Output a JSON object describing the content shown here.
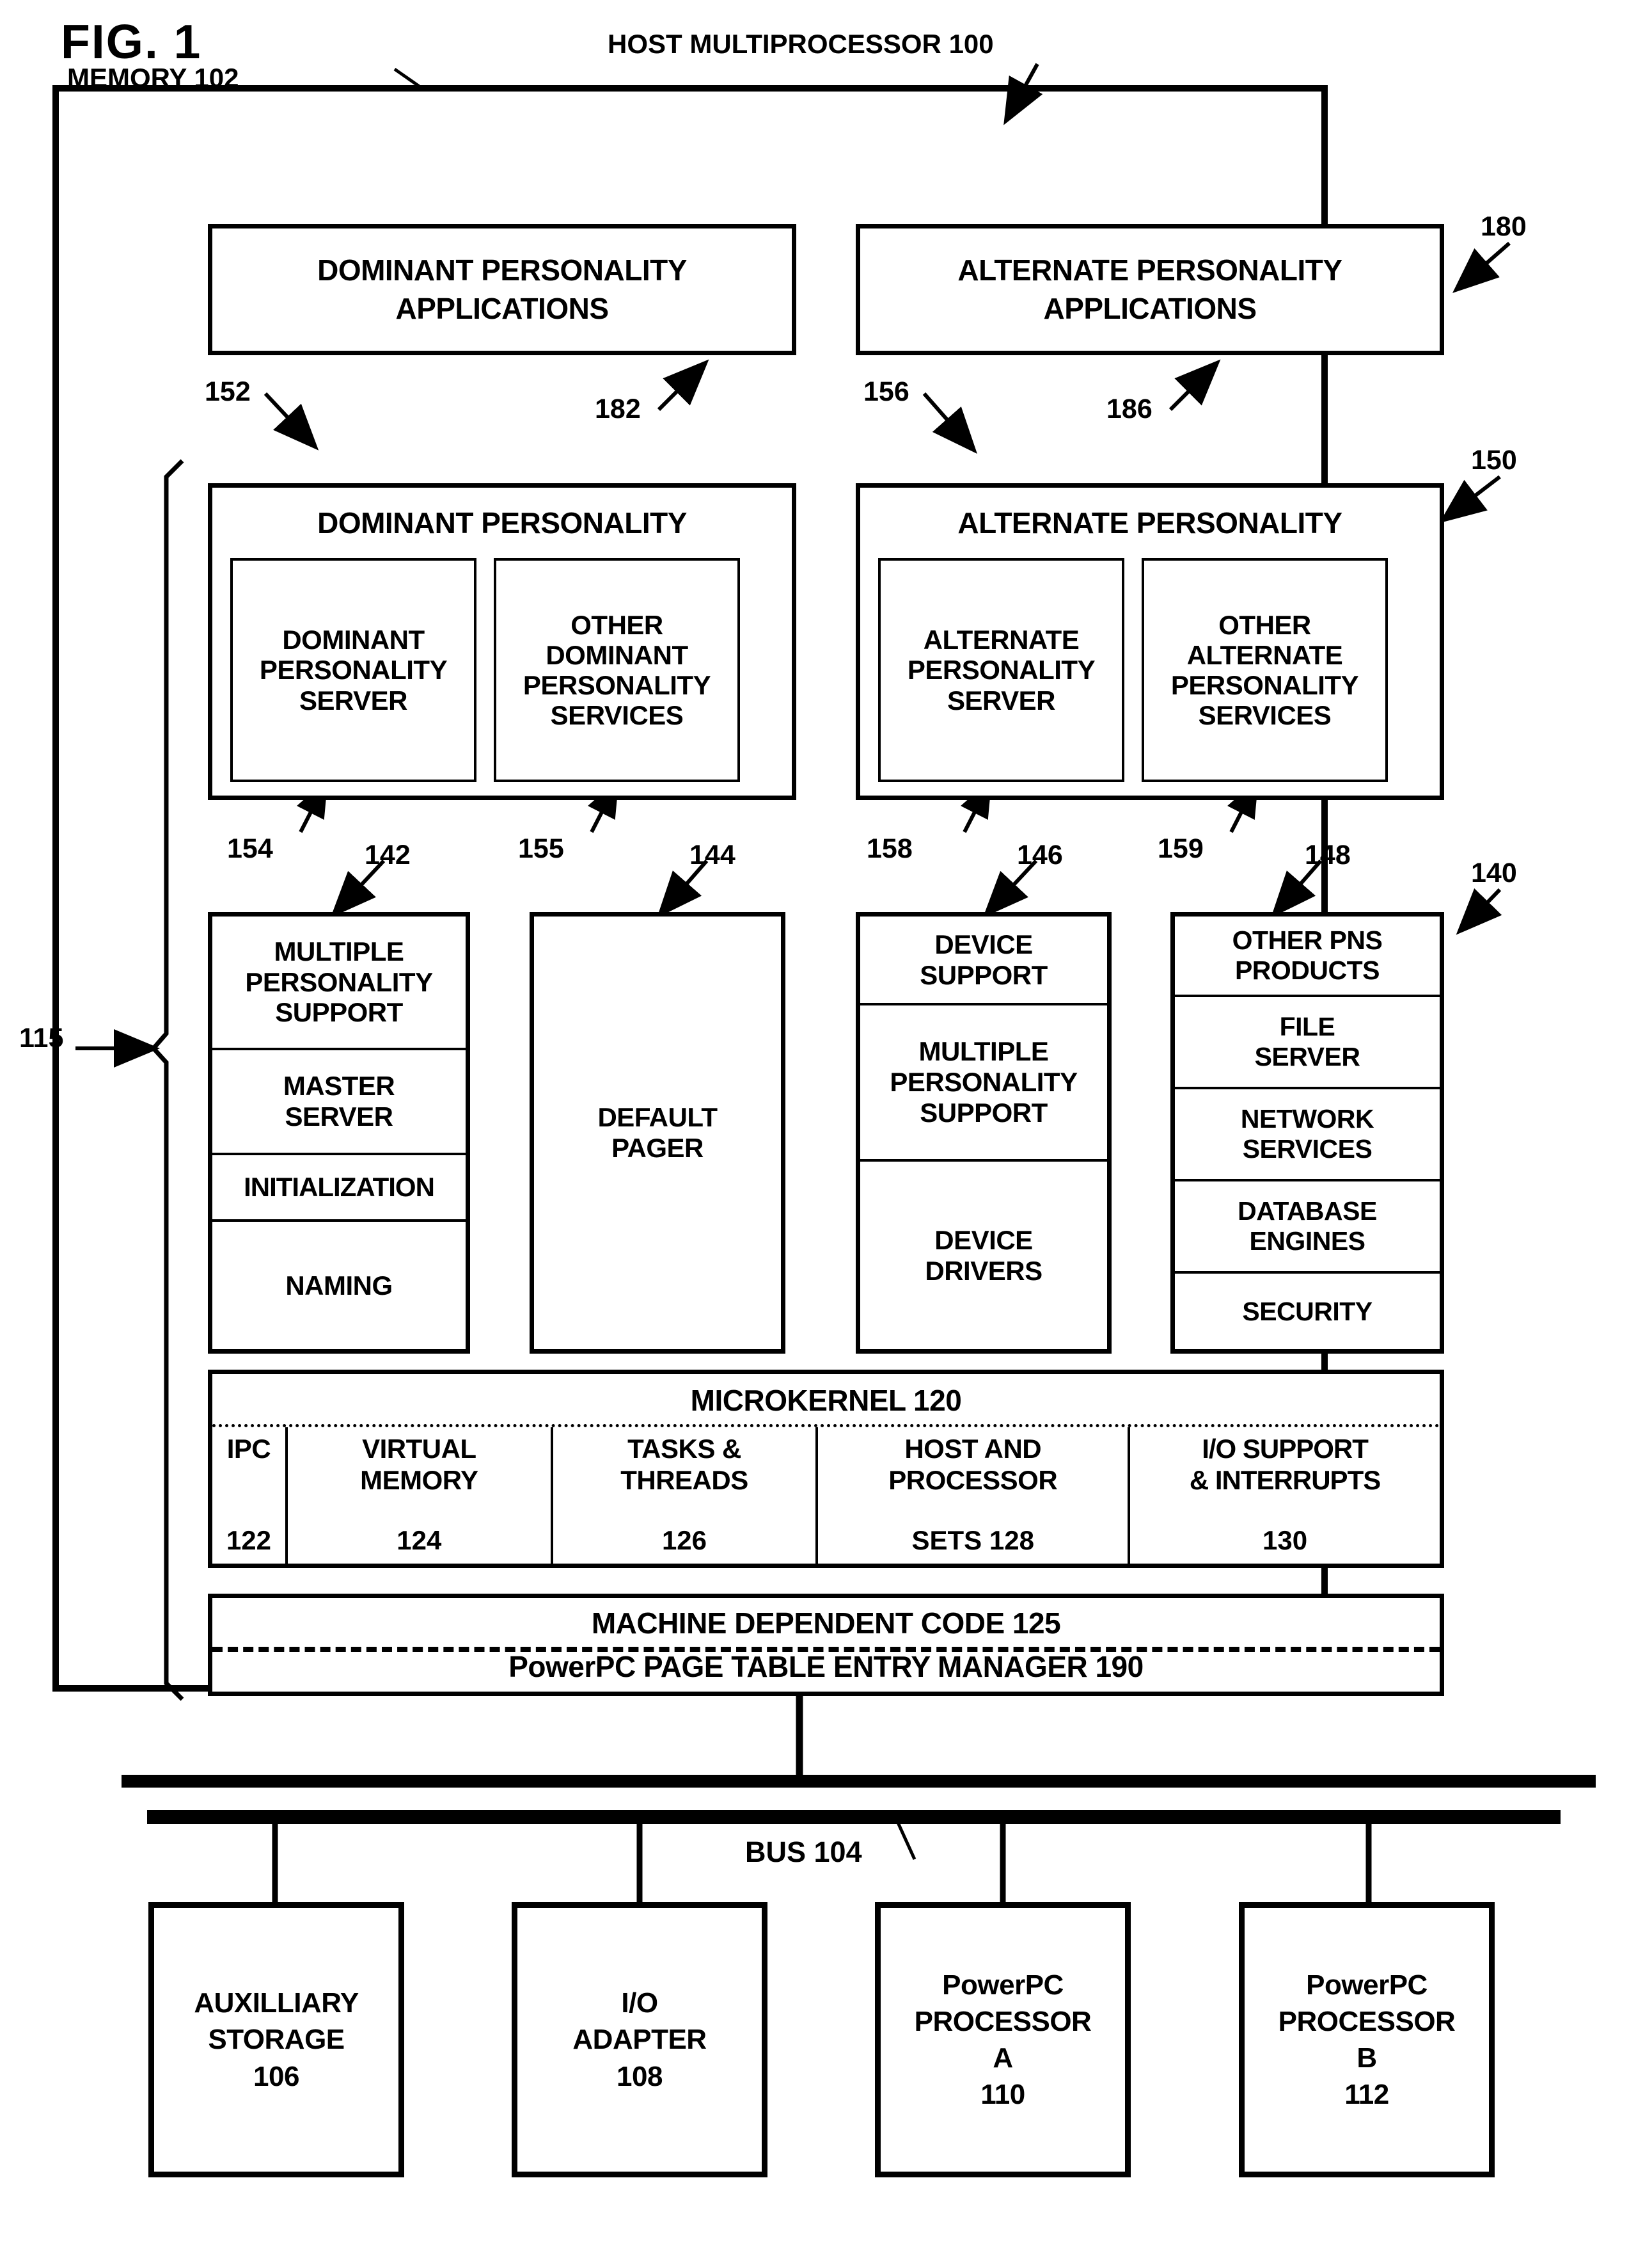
{
  "figure": {
    "label": "FIG. 1",
    "host_title": "HOST MULTIPROCESSOR 100",
    "memory_title": "MEMORY 102"
  },
  "applications": {
    "dominant": {
      "line1": "DOMINANT PERSONALITY",
      "line2": "APPLICATIONS",
      "ref": "182"
    },
    "alternate": {
      "line1": "ALTERNATE PERSONALITY",
      "line2": "APPLICATIONS",
      "ref": "186"
    }
  },
  "personalities": {
    "dominant": {
      "title": "DOMINANT PERSONALITY",
      "ref": "152",
      "server": {
        "lines": [
          "DOMINANT",
          "PERSONALITY",
          "SERVER"
        ],
        "ref": "154"
      },
      "services": {
        "lines": [
          "OTHER",
          "DOMINANT",
          "PERSONALITY",
          "SERVICES"
        ],
        "ref": "155"
      }
    },
    "alternate": {
      "title": "ALTERNATE PERSONALITY",
      "ref": "156",
      "server": {
        "lines": [
          "ALTERNATE",
          "PERSONALITY",
          "SERVER"
        ],
        "ref": "158"
      },
      "services": {
        "lines": [
          "OTHER",
          "ALTERNATE",
          "PERSONALITY",
          "SERVICES"
        ],
        "ref": "159"
      }
    }
  },
  "pns_columns": [
    {
      "ref": "142",
      "cells": [
        {
          "lines": [
            "MULTIPLE",
            "PERSONALITY",
            "SUPPORT"
          ]
        },
        {
          "lines": [
            "MASTER",
            "SERVER"
          ]
        },
        {
          "lines": [
            "INITIALIZATION"
          ]
        },
        {
          "lines": [
            "NAMING"
          ]
        }
      ]
    },
    {
      "ref": "144",
      "cells": [
        {
          "lines": [
            "DEFAULT",
            "PAGER"
          ]
        }
      ]
    },
    {
      "ref": "146",
      "cells": [
        {
          "lines": [
            "DEVICE",
            "SUPPORT"
          ]
        },
        {
          "lines": [
            "MULTIPLE",
            "PERSONALITY",
            "SUPPORT"
          ]
        },
        {
          "lines": [
            "DEVICE",
            "DRIVERS"
          ]
        }
      ]
    },
    {
      "ref": "148",
      "cells": [
        {
          "lines": [
            "OTHER PNS",
            "PRODUCTS"
          ]
        },
        {
          "lines": [
            "FILE",
            "SERVER"
          ]
        },
        {
          "lines": [
            "NETWORK",
            "SERVICES"
          ]
        },
        {
          "lines": [
            "DATABASE",
            "ENGINES"
          ]
        },
        {
          "lines": [
            "SECURITY"
          ]
        }
      ]
    }
  ],
  "microkernel": {
    "title": "MICROKERNEL  120",
    "columns": [
      {
        "lines": [
          "IPC"
        ],
        "num": "122"
      },
      {
        "lines": [
          "VIRTUAL",
          "MEMORY"
        ],
        "num": "124"
      },
      {
        "lines": [
          "TASKS &",
          "THREADS"
        ],
        "num": "126"
      },
      {
        "lines": [
          "HOST AND",
          "PROCESSOR"
        ],
        "num": "SETS  128"
      },
      {
        "lines": [
          "I/O SUPPORT",
          "& INTERRUPTS"
        ],
        "num": "130"
      }
    ]
  },
  "machine_dependent": {
    "code_label": "MACHINE DEPENDENT CODE   125",
    "ptem_label": "PowerPC PAGE TABLE ENTRY MANAGER 190"
  },
  "bus": {
    "label": "BUS 104"
  },
  "hardware": [
    {
      "lines": [
        "AUXILLIARY",
        "STORAGE"
      ],
      "num": "106"
    },
    {
      "lines": [
        "I/O",
        "ADAPTER"
      ],
      "num": "108"
    },
    {
      "lines": [
        "PowerPC",
        "PROCESSOR",
        "A"
      ],
      "num": "110"
    },
    {
      "lines": [
        "PowerPC",
        "PROCESSOR",
        "B"
      ],
      "num": "112"
    }
  ],
  "reference_numbers": {
    "host": "100",
    "memory": "102",
    "bracket_115": "115",
    "personalities_group": "150",
    "apps_group": "180",
    "pns_group": "140"
  },
  "colors": {
    "ink": "#000000",
    "paper": "#ffffff"
  }
}
